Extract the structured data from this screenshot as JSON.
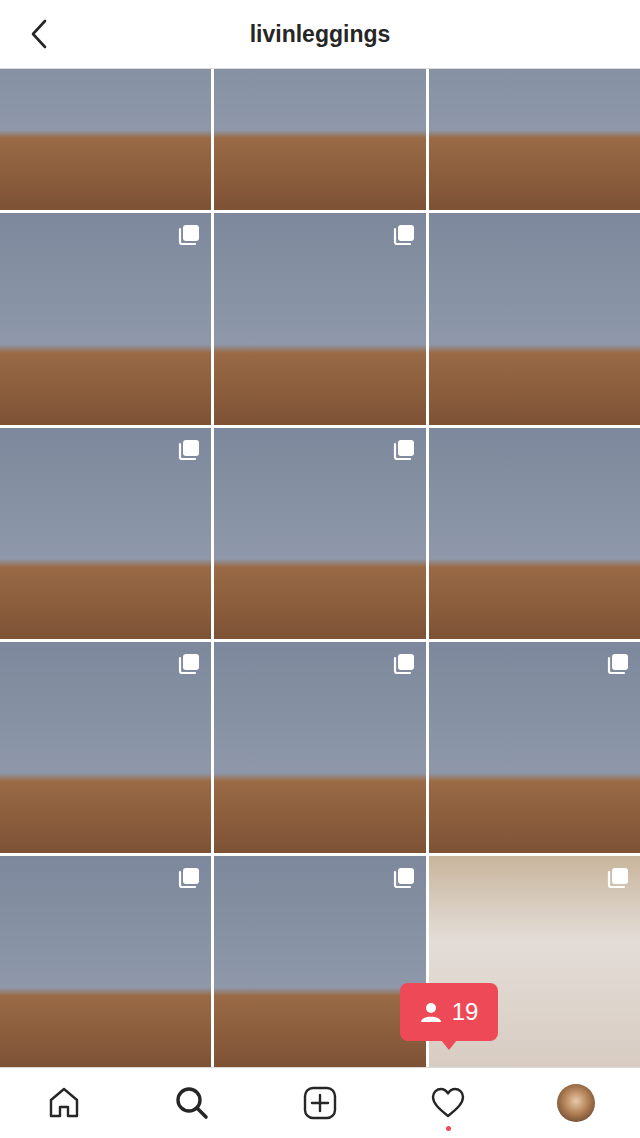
{
  "header": {
    "title": "livinleggings"
  },
  "posts": [
    {
      "carousel": false
    },
    {
      "carousel": false
    },
    {
      "carousel": false
    },
    {
      "carousel": true
    },
    {
      "carousel": true
    },
    {
      "carousel": false
    },
    {
      "carousel": true
    },
    {
      "carousel": true
    },
    {
      "carousel": false
    },
    {
      "carousel": true
    },
    {
      "carousel": true
    },
    {
      "carousel": true
    },
    {
      "carousel": true
    },
    {
      "carousel": true
    },
    {
      "carousel": true
    }
  ],
  "activity_badge": {
    "count": "19"
  },
  "nav": [
    {
      "kind": "home",
      "selected": false,
      "dot": false
    },
    {
      "kind": "search",
      "selected": true,
      "dot": false
    },
    {
      "kind": "add",
      "selected": false,
      "dot": false
    },
    {
      "kind": "activity",
      "selected": false,
      "dot": true
    },
    {
      "kind": "profile",
      "selected": false,
      "dot": false
    }
  ]
}
